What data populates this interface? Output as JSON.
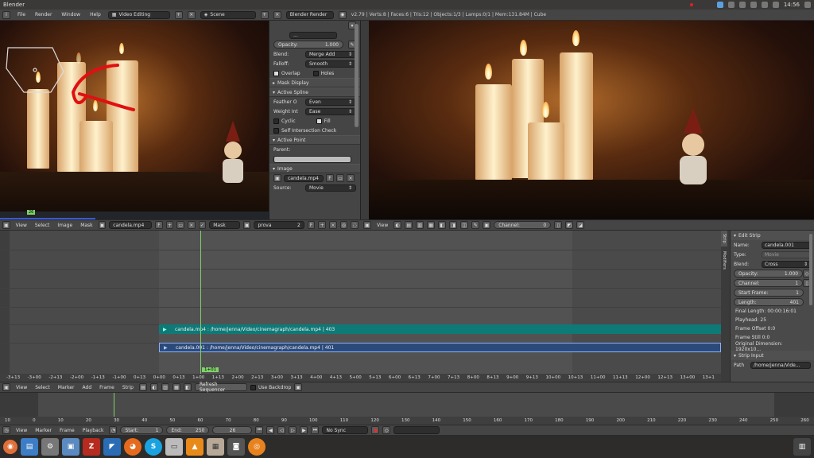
{
  "os_bar": {
    "app_title": "Blender",
    "time": "14:56"
  },
  "info_bar": {
    "menus": [
      "File",
      "Render",
      "Window",
      "Help"
    ],
    "screen_layout": "Video Editing",
    "scene": "Scene",
    "engine": "Blender Render",
    "stats": "v2.79 | Verts:8 | Faces:6 | Tris:12 | Objects:1/3 | Lamps:0/1 | Mem:131.84M | Cube"
  },
  "mask_panel": {
    "opacity_label": "Opacity:",
    "opacity_value": "1.000",
    "blend_label": "Blend:",
    "blend_value": "Merge Add",
    "falloff_label": "Falloff:",
    "falloff_value": "Smooth",
    "overlap_label": "Overlap",
    "holes_label": "Holes",
    "mask_display_header": "Mask Display",
    "active_spline_header": "Active Spline",
    "feather_label": "Feather O",
    "feather_value": "Even",
    "weight_label": "Weight Int",
    "weight_value": "Ease",
    "cyclic_label": "Cyclic",
    "fill_label": "Fill",
    "self_intersection_label": "Self Intersection Check",
    "active_point_header": "Active Point",
    "parent_label": "Parent:",
    "image_header": "Image",
    "image_name": "candela.mp4",
    "image_f": "F",
    "source_label": "Source:",
    "source_value": "Movie"
  },
  "clip_header": {
    "menus": [
      "View",
      "Select",
      "Image",
      "Mask"
    ],
    "image_name": "candela.mp4",
    "image_f": "F",
    "mode": "Mask",
    "mask_name": "prova",
    "mask_users": "2",
    "mask_f": "F",
    "frame_badge": "26"
  },
  "preview_header": {
    "menus": [
      "View"
    ],
    "channel_label": "Channel:",
    "channel_value": "0"
  },
  "sequencer": {
    "strips": [
      {
        "label": "candela.mp4 : /home/jenna/Video/cinemagraph/candela.mp4 | 403",
        "color": "#0e7a78"
      },
      {
        "label": "candela.001 : /home/jenna/Video/cinemagraph/candela.mp4 | 401",
        "color": "#2b4a7a"
      }
    ],
    "playhead_label": "1+01",
    "ruler_labels": [
      "-3+13",
      "-3+00",
      "-2+13",
      "-2+00",
      "-1+13",
      "-1+00",
      "0+13",
      "0+00",
      "0+13",
      "1+00",
      "1+13",
      "2+00",
      "2+13",
      "3+00",
      "3+13",
      "4+00",
      "4+13",
      "5+00",
      "5+13",
      "6+00",
      "6+13",
      "7+00",
      "7+13",
      "8+00",
      "8+13",
      "9+00",
      "9+13",
      "10+00",
      "10+13",
      "11+00",
      "11+13",
      "12+00",
      "12+13",
      "13+00",
      "13+1"
    ]
  },
  "edit_strip": {
    "tabs": [
      "Strip",
      "Modifiers"
    ],
    "header": "Edit Strip",
    "name_label": "Name:",
    "name_value": "candela.001",
    "type_label": "Type:",
    "type_value": "Movie",
    "blend_label": "Blend:",
    "blend_value": "Cross",
    "opacity_label": "Opacity:",
    "opacity_value": "1.000",
    "channel_label": "Channel:",
    "channel_value": "1",
    "start_label": "Start Frame:",
    "start_value": "1",
    "length_label": "Length:",
    "length_value": "401",
    "final_length": "Final Length: 00:00:16:01",
    "playhead": "Playhead: 25",
    "frame_offset": "Frame Offset 0:0",
    "frame_still": "Frame Still 0:0",
    "orig_dim": "Original Dimension: 1920x10...",
    "strip_input_header": "Strip Input",
    "path_label": "Path",
    "path_value": "/home/jenna/Vide..."
  },
  "seq_header": {
    "menus": [
      "View",
      "Select",
      "Marker",
      "Add",
      "Frame",
      "Strip"
    ],
    "refresh_label": "Refresh Sequencer",
    "backdrop_label": "Use Backdrop"
  },
  "timeline": {
    "labels": [
      "10",
      "0",
      "10",
      "20",
      "30",
      "40",
      "50",
      "60",
      "70",
      "80",
      "90",
      "100",
      "110",
      "120",
      "130",
      "140",
      "150",
      "160",
      "170",
      "180",
      "190",
      "200",
      "210",
      "220",
      "230",
      "240",
      "250",
      "260"
    ],
    "menus": [
      "View",
      "Marker",
      "Frame",
      "Playback"
    ],
    "start_label": "Start:",
    "start_value": "1",
    "end_label": "End:",
    "end_value": "250",
    "current_frame": "26",
    "sync": "No Sync"
  },
  "taskbar": {
    "icons": [
      "files-icon",
      "settings-icon",
      "installer-icon",
      "filezilla-icon",
      "vscode-icon",
      "firefox-icon",
      "skype-icon",
      "drive-icon",
      "vlc-icon",
      "screenshot-icon",
      "camera-icon",
      "blender-icon"
    ],
    "trash": "trash-icon"
  },
  "colors": {
    "accent_green": "#7fd16a",
    "strip_teal": "#0e7a78",
    "strip_blue": "#2b4a7a",
    "annotation_red": "#e01010"
  }
}
